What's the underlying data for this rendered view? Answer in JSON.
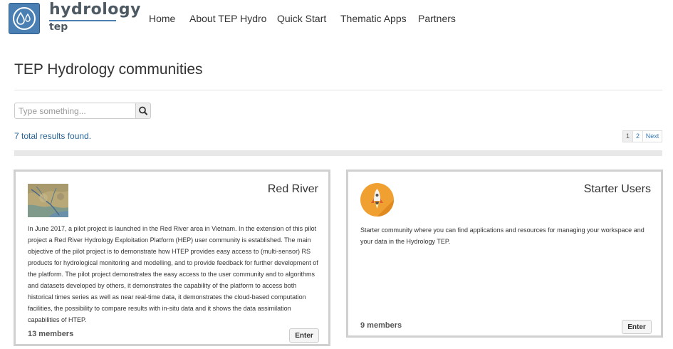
{
  "header": {
    "logo_main": "hydrology",
    "logo_sub": "tep",
    "nav": [
      "Home",
      "About TEP Hydro",
      "Quick Start",
      "Thematic Apps",
      "Partners"
    ]
  },
  "page": {
    "title": "TEP Hydrology communities",
    "search_placeholder": "Type something...",
    "results": "7 total results found.",
    "pagination": [
      "1",
      "2",
      "Next"
    ]
  },
  "communities": [
    {
      "name": "Red River",
      "icon": "red-river-map-thumbnail",
      "description": "In June 2017, a pilot project is launched in the Red River area in Vietnam. In the extension of this pilot project a Red River Hydrology Exploitation Platform (HEP) user community is established. The main objective of the pilot project is to demonstrate how HTEP provides easy access to (multi-sensor) RS products for hydrological monitoring and modelling, and to provide feedback for further development of the platform. The pilot project demonstrates the easy access to the user community and to algorithms and datasets developed by others, it demonstrates the capability of the platform to access both historical times series as well as near real-time data, it demonstrates the cloud-based computation facilities, the possibility to compare results with in-situ data and it shows the data assimilation capabilities of HTEP.",
      "members": "13 members",
      "enter_label": "Enter"
    },
    {
      "name": "Starter Users",
      "icon": "rocket-icon",
      "description": "Starter community where you can find applications and resources for managing your workspace and your data in the Hydrology TEP.",
      "members": "9 members",
      "enter_label": "Enter"
    }
  ],
  "colors": {
    "logo_blue": "#4a7fb3",
    "link_blue": "#2a6496",
    "rocket_orange": "#f0a030"
  }
}
